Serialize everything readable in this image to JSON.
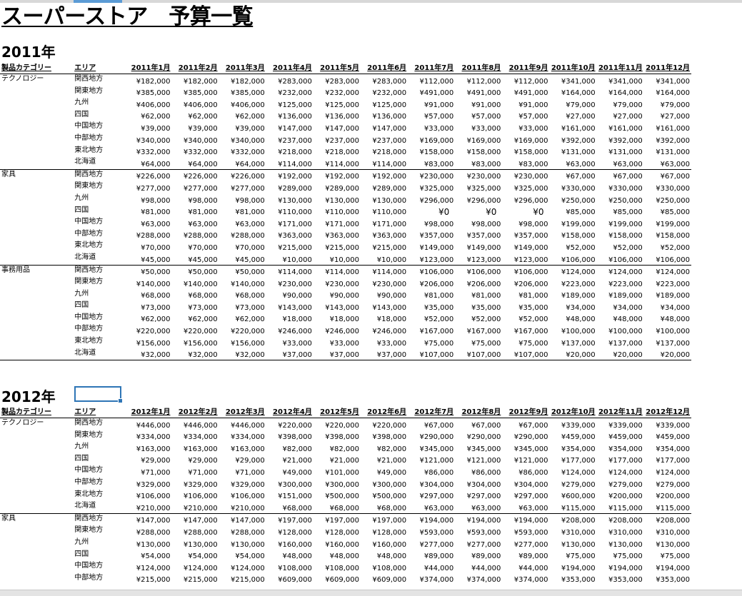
{
  "sheet": {
    "title": "スーパーストア　予算一覧"
  },
  "sections": [
    {
      "year_label": "2011年",
      "header": {
        "category": "製品カテゴリー",
        "area": "エリア",
        "months": [
          "2011年1月",
          "2011年2月",
          "2011年3月",
          "2011年4月",
          "2011年5月",
          "2011年6月",
          "2011年7月",
          "2011年8月",
          "2011年9月",
          "2011年10月",
          "2011年11月",
          "2011年12月"
        ]
      },
      "groups": [
        {
          "category": "テクノロジー",
          "rows": [
            {
              "area": "関西地方",
              "values": [
                "¥182,000",
                "¥182,000",
                "¥182,000",
                "¥283,000",
                "¥283,000",
                "¥283,000",
                "¥112,000",
                "¥112,000",
                "¥112,000",
                "¥341,000",
                "¥341,000",
                "¥341,000"
              ]
            },
            {
              "area": "関東地方",
              "values": [
                "¥385,000",
                "¥385,000",
                "¥385,000",
                "¥232,000",
                "¥232,000",
                "¥232,000",
                "¥491,000",
                "¥491,000",
                "¥491,000",
                "¥164,000",
                "¥164,000",
                "¥164,000"
              ]
            },
            {
              "area": "九州",
              "values": [
                "¥406,000",
                "¥406,000",
                "¥406,000",
                "¥125,000",
                "¥125,000",
                "¥125,000",
                "¥91,000",
                "¥91,000",
                "¥91,000",
                "¥79,000",
                "¥79,000",
                "¥79,000"
              ]
            },
            {
              "area": "四国",
              "values": [
                "¥62,000",
                "¥62,000",
                "¥62,000",
                "¥136,000",
                "¥136,000",
                "¥136,000",
                "¥57,000",
                "¥57,000",
                "¥57,000",
                "¥27,000",
                "¥27,000",
                "¥27,000"
              ]
            },
            {
              "area": "中国地方",
              "values": [
                "¥39,000",
                "¥39,000",
                "¥39,000",
                "¥147,000",
                "¥147,000",
                "¥147,000",
                "¥33,000",
                "¥33,000",
                "¥33,000",
                "¥161,000",
                "¥161,000",
                "¥161,000"
              ]
            },
            {
              "area": "中部地方",
              "values": [
                "¥340,000",
                "¥340,000",
                "¥340,000",
                "¥237,000",
                "¥237,000",
                "¥237,000",
                "¥169,000",
                "¥169,000",
                "¥169,000",
                "¥392,000",
                "¥392,000",
                "¥392,000"
              ]
            },
            {
              "area": "東北地方",
              "values": [
                "¥332,000",
                "¥332,000",
                "¥332,000",
                "¥218,000",
                "¥218,000",
                "¥218,000",
                "¥158,000",
                "¥158,000",
                "¥158,000",
                "¥131,000",
                "¥131,000",
                "¥131,000"
              ]
            },
            {
              "area": "北海道",
              "values": [
                "¥64,000",
                "¥64,000",
                "¥64,000",
                "¥114,000",
                "¥114,000",
                "¥114,000",
                "¥83,000",
                "¥83,000",
                "¥83,000",
                "¥63,000",
                "¥63,000",
                "¥63,000"
              ]
            }
          ]
        },
        {
          "category": "家具",
          "rows": [
            {
              "area": "関西地方",
              "values": [
                "¥226,000",
                "¥226,000",
                "¥226,000",
                "¥192,000",
                "¥192,000",
                "¥192,000",
                "¥230,000",
                "¥230,000",
                "¥230,000",
                "¥67,000",
                "¥67,000",
                "¥67,000"
              ]
            },
            {
              "area": "関東地方",
              "values": [
                "¥277,000",
                "¥277,000",
                "¥277,000",
                "¥289,000",
                "¥289,000",
                "¥289,000",
                "¥325,000",
                "¥325,000",
                "¥325,000",
                "¥330,000",
                "¥330,000",
                "¥330,000"
              ]
            },
            {
              "area": "九州",
              "values": [
                "¥98,000",
                "¥98,000",
                "¥98,000",
                "¥130,000",
                "¥130,000",
                "¥130,000",
                "¥296,000",
                "¥296,000",
                "¥296,000",
                "¥250,000",
                "¥250,000",
                "¥250,000"
              ]
            },
            {
              "area": "四国",
              "values": [
                "¥81,000",
                "¥81,000",
                "¥81,000",
                "¥110,000",
                "¥110,000",
                "¥110,000",
                "¥0",
                "¥0",
                "¥0",
                "¥85,000",
                "¥85,000",
                "¥85,000"
              ]
            },
            {
              "area": "中国地方",
              "values": [
                "¥63,000",
                "¥63,000",
                "¥63,000",
                "¥171,000",
                "¥171,000",
                "¥171,000",
                "¥98,000",
                "¥98,000",
                "¥98,000",
                "¥199,000",
                "¥199,000",
                "¥199,000"
              ]
            },
            {
              "area": "中部地方",
              "values": [
                "¥288,000",
                "¥288,000",
                "¥288,000",
                "¥363,000",
                "¥363,000",
                "¥363,000",
                "¥357,000",
                "¥357,000",
                "¥357,000",
                "¥158,000",
                "¥158,000",
                "¥158,000"
              ]
            },
            {
              "area": "東北地方",
              "values": [
                "¥70,000",
                "¥70,000",
                "¥70,000",
                "¥215,000",
                "¥215,000",
                "¥215,000",
                "¥149,000",
                "¥149,000",
                "¥149,000",
                "¥52,000",
                "¥52,000",
                "¥52,000"
              ]
            },
            {
              "area": "北海道",
              "values": [
                "¥45,000",
                "¥45,000",
                "¥45,000",
                "¥10,000",
                "¥10,000",
                "¥10,000",
                "¥123,000",
                "¥123,000",
                "¥123,000",
                "¥106,000",
                "¥106,000",
                "¥106,000"
              ]
            }
          ]
        },
        {
          "category": "事務用品",
          "rows": [
            {
              "area": "関西地方",
              "values": [
                "¥50,000",
                "¥50,000",
                "¥50,000",
                "¥114,000",
                "¥114,000",
                "¥114,000",
                "¥106,000",
                "¥106,000",
                "¥106,000",
                "¥124,000",
                "¥124,000",
                "¥124,000"
              ]
            },
            {
              "area": "関東地方",
              "values": [
                "¥140,000",
                "¥140,000",
                "¥140,000",
                "¥230,000",
                "¥230,000",
                "¥230,000",
                "¥206,000",
                "¥206,000",
                "¥206,000",
                "¥223,000",
                "¥223,000",
                "¥223,000"
              ]
            },
            {
              "area": "九州",
              "values": [
                "¥68,000",
                "¥68,000",
                "¥68,000",
                "¥90,000",
                "¥90,000",
                "¥90,000",
                "¥81,000",
                "¥81,000",
                "¥81,000",
                "¥189,000",
                "¥189,000",
                "¥189,000"
              ]
            },
            {
              "area": "四国",
              "values": [
                "¥73,000",
                "¥73,000",
                "¥73,000",
                "¥143,000",
                "¥143,000",
                "¥143,000",
                "¥35,000",
                "¥35,000",
                "¥35,000",
                "¥34,000",
                "¥34,000",
                "¥34,000"
              ]
            },
            {
              "area": "中国地方",
              "values": [
                "¥62,000",
                "¥62,000",
                "¥62,000",
                "¥18,000",
                "¥18,000",
                "¥18,000",
                "¥52,000",
                "¥52,000",
                "¥52,000",
                "¥48,000",
                "¥48,000",
                "¥48,000"
              ]
            },
            {
              "area": "中部地方",
              "values": [
                "¥220,000",
                "¥220,000",
                "¥220,000",
                "¥246,000",
                "¥246,000",
                "¥246,000",
                "¥167,000",
                "¥167,000",
                "¥167,000",
                "¥100,000",
                "¥100,000",
                "¥100,000"
              ]
            },
            {
              "area": "東北地方",
              "values": [
                "¥156,000",
                "¥156,000",
                "¥156,000",
                "¥33,000",
                "¥33,000",
                "¥33,000",
                "¥75,000",
                "¥75,000",
                "¥75,000",
                "¥137,000",
                "¥137,000",
                "¥137,000"
              ]
            },
            {
              "area": "北海道",
              "values": [
                "¥32,000",
                "¥32,000",
                "¥32,000",
                "¥37,000",
                "¥37,000",
                "¥37,000",
                "¥107,000",
                "¥107,000",
                "¥107,000",
                "¥20,000",
                "¥20,000",
                "¥20,000"
              ]
            }
          ]
        }
      ]
    },
    {
      "year_label": "2012年",
      "header": {
        "category": "製品カテゴリー",
        "area": "エリア",
        "months": [
          "2012年1月",
          "2012年2月",
          "2012年3月",
          "2012年4月",
          "2012年5月",
          "2012年6月",
          "2012年7月",
          "2012年8月",
          "2012年9月",
          "2012年10月",
          "2012年11月",
          "2012年12月"
        ]
      },
      "groups": [
        {
          "category": "テクノロジー",
          "rows": [
            {
              "area": "関西地方",
              "values": [
                "¥446,000",
                "¥446,000",
                "¥446,000",
                "¥220,000",
                "¥220,000",
                "¥220,000",
                "¥67,000",
                "¥67,000",
                "¥67,000",
                "¥339,000",
                "¥339,000",
                "¥339,000"
              ]
            },
            {
              "area": "関東地方",
              "values": [
                "¥334,000",
                "¥334,000",
                "¥334,000",
                "¥398,000",
                "¥398,000",
                "¥398,000",
                "¥290,000",
                "¥290,000",
                "¥290,000",
                "¥459,000",
                "¥459,000",
                "¥459,000"
              ]
            },
            {
              "area": "九州",
              "values": [
                "¥163,000",
                "¥163,000",
                "¥163,000",
                "¥82,000",
                "¥82,000",
                "¥82,000",
                "¥345,000",
                "¥345,000",
                "¥345,000",
                "¥354,000",
                "¥354,000",
                "¥354,000"
              ]
            },
            {
              "area": "四国",
              "values": [
                "¥29,000",
                "¥29,000",
                "¥29,000",
                "¥21,000",
                "¥21,000",
                "¥21,000",
                "¥121,000",
                "¥121,000",
                "¥121,000",
                "¥177,000",
                "¥177,000",
                "¥177,000"
              ]
            },
            {
              "area": "中国地方",
              "values": [
                "¥71,000",
                "¥71,000",
                "¥71,000",
                "¥49,000",
                "¥101,000",
                "¥49,000",
                "¥86,000",
                "¥86,000",
                "¥86,000",
                "¥124,000",
                "¥124,000",
                "¥124,000"
              ]
            },
            {
              "area": "中部地方",
              "values": [
                "¥329,000",
                "¥329,000",
                "¥329,000",
                "¥300,000",
                "¥300,000",
                "¥300,000",
                "¥304,000",
                "¥304,000",
                "¥304,000",
                "¥279,000",
                "¥279,000",
                "¥279,000"
              ]
            },
            {
              "area": "東北地方",
              "values": [
                "¥106,000",
                "¥106,000",
                "¥106,000",
                "¥151,000",
                "¥500,000",
                "¥500,000",
                "¥297,000",
                "¥297,000",
                "¥297,000",
                "¥600,000",
                "¥200,000",
                "¥200,000"
              ]
            },
            {
              "area": "北海道",
              "values": [
                "¥210,000",
                "¥210,000",
                "¥210,000",
                "¥68,000",
                "¥68,000",
                "¥68,000",
                "¥63,000",
                "¥63,000",
                "¥63,000",
                "¥115,000",
                "¥115,000",
                "¥115,000"
              ]
            }
          ]
        },
        {
          "category": "家具",
          "rows": [
            {
              "area": "関西地方",
              "values": [
                "¥147,000",
                "¥147,000",
                "¥147,000",
                "¥197,000",
                "¥197,000",
                "¥197,000",
                "¥194,000",
                "¥194,000",
                "¥194,000",
                "¥208,000",
                "¥208,000",
                "¥208,000"
              ]
            },
            {
              "area": "関東地方",
              "values": [
                "¥288,000",
                "¥288,000",
                "¥288,000",
                "¥128,000",
                "¥128,000",
                "¥128,000",
                "¥593,000",
                "¥593,000",
                "¥593,000",
                "¥310,000",
                "¥310,000",
                "¥310,000"
              ]
            },
            {
              "area": "九州",
              "values": [
                "¥130,000",
                "¥130,000",
                "¥130,000",
                "¥160,000",
                "¥160,000",
                "¥160,000",
                "¥277,000",
                "¥277,000",
                "¥277,000",
                "¥130,000",
                "¥130,000",
                "¥130,000"
              ]
            },
            {
              "area": "四国",
              "values": [
                "¥54,000",
                "¥54,000",
                "¥54,000",
                "¥48,000",
                "¥48,000",
                "¥48,000",
                "¥89,000",
                "¥89,000",
                "¥89,000",
                "¥75,000",
                "¥75,000",
                "¥75,000"
              ]
            },
            {
              "area": "中国地方",
              "values": [
                "¥124,000",
                "¥124,000",
                "¥124,000",
                "¥108,000",
                "¥108,000",
                "¥108,000",
                "¥44,000",
                "¥44,000",
                "¥44,000",
                "¥194,000",
                "¥194,000",
                "¥194,000"
              ]
            },
            {
              "area": "中部地方",
              "values": [
                "¥215,000",
                "¥215,000",
                "¥215,000",
                "¥609,000",
                "¥609,000",
                "¥609,000",
                "¥374,000",
                "¥374,000",
                "¥374,000",
                "¥353,000",
                "¥353,000",
                "¥353,000"
              ]
            }
          ]
        }
      ]
    }
  ]
}
